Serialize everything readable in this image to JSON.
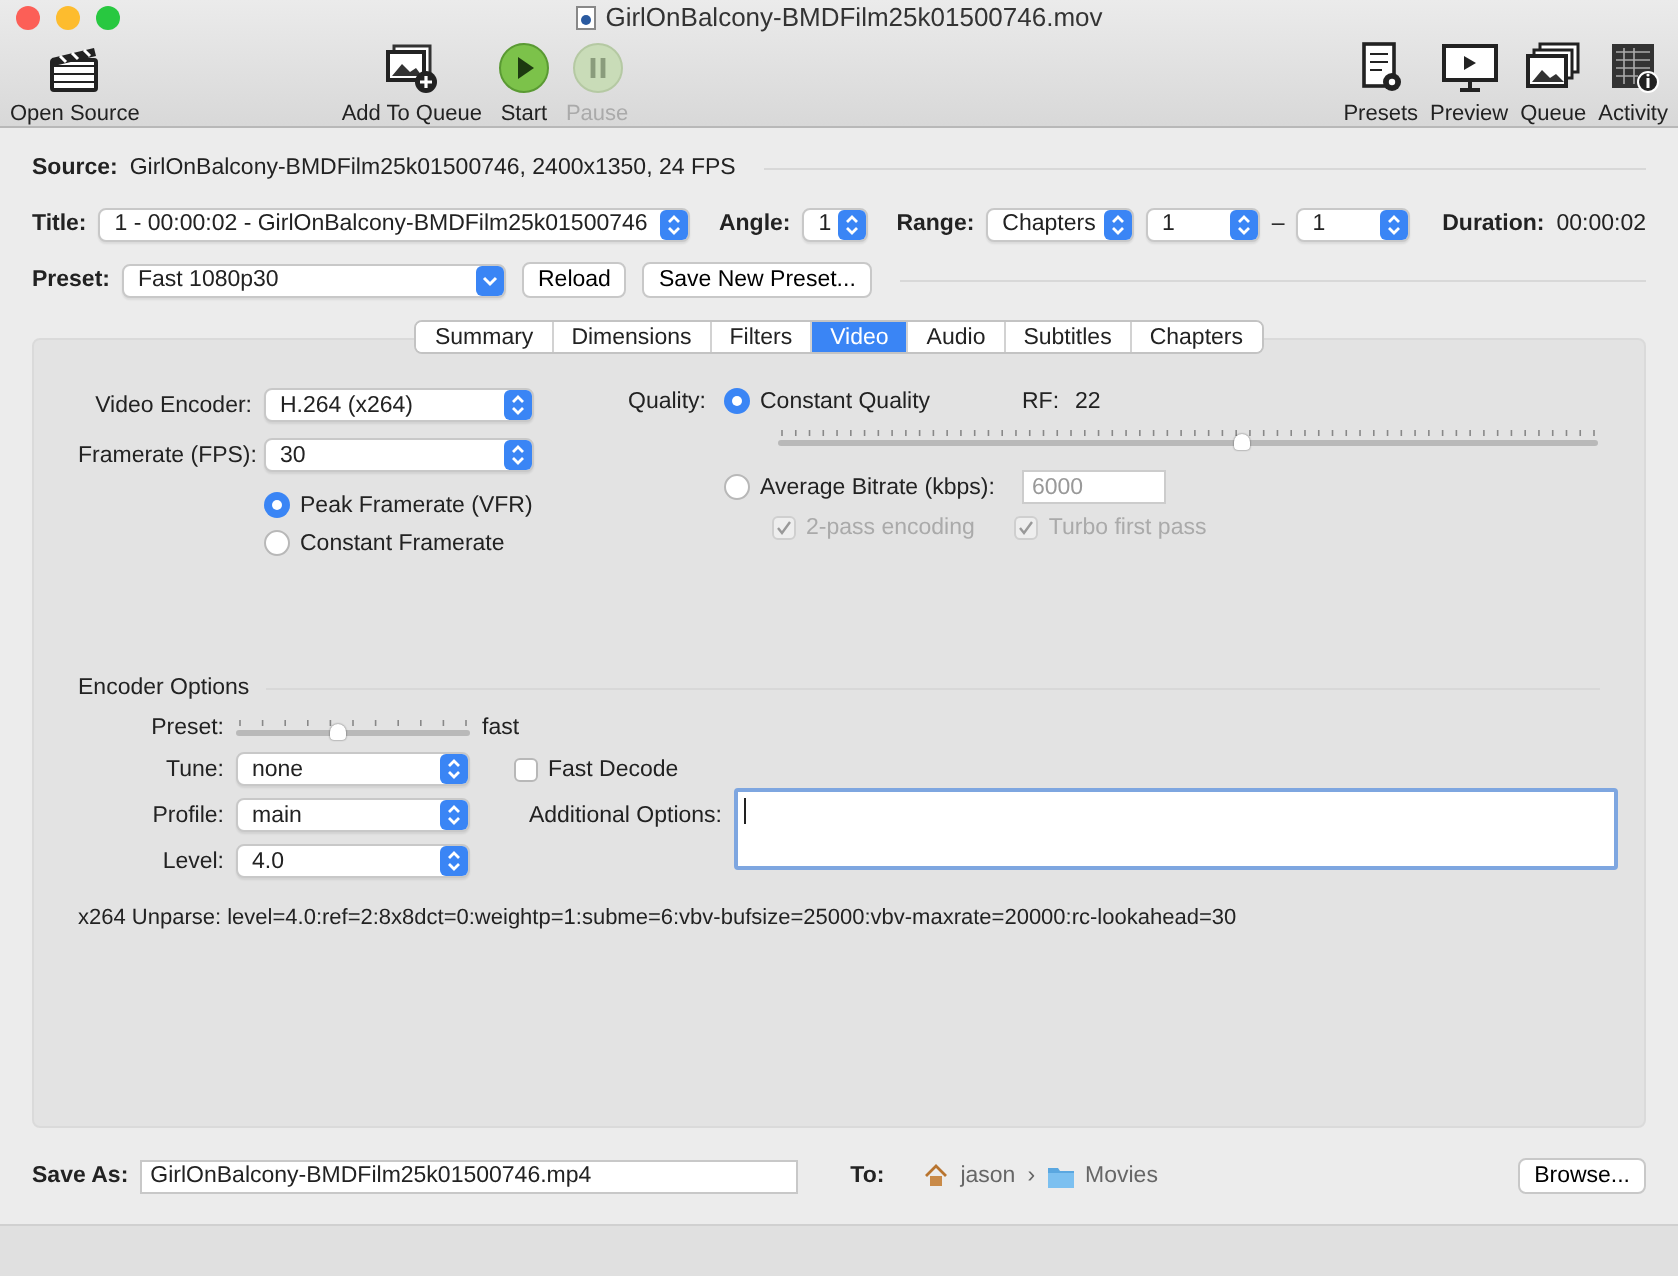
{
  "window": {
    "title": "GirlOnBalcony-BMDFilm25k01500746.mov"
  },
  "toolbar": {
    "left": [
      {
        "kind": "clapper",
        "label": "Open Source",
        "disabled": false
      },
      {
        "kind": "add-queue",
        "label": "Add To Queue",
        "disabled": false
      },
      {
        "kind": "start",
        "label": "Start",
        "disabled": false
      },
      {
        "kind": "pause",
        "label": "Pause",
        "disabled": true
      }
    ],
    "right": [
      {
        "kind": "presets",
        "label": "Presets",
        "disabled": false
      },
      {
        "kind": "preview",
        "label": "Preview",
        "disabled": false
      },
      {
        "kind": "queue",
        "label": "Queue",
        "disabled": false
      },
      {
        "kind": "activity",
        "label": "Activity",
        "disabled": false
      }
    ]
  },
  "source": {
    "label": "Source:",
    "value": "GirlOnBalcony-BMDFilm25k01500746, 2400x1350, 24 FPS"
  },
  "title_row": {
    "title_label": "Title:",
    "title_value": "1 - 00:00:02 - GirlOnBalcony-BMDFilm25k01500746",
    "angle_label": "Angle:",
    "angle_value": "1",
    "range_label": "Range:",
    "range_mode": "Chapters",
    "range_start": "1",
    "range_separator": "–",
    "range_end": "1",
    "duration_label": "Duration:",
    "duration_value": "00:00:02"
  },
  "preset_row": {
    "label": "Preset:",
    "value": "Fast 1080p30",
    "buttons": [
      "Reload",
      "Save New Preset..."
    ]
  },
  "tabs": [
    {
      "label": "Summary",
      "selected": false
    },
    {
      "label": "Dimensions",
      "selected": false
    },
    {
      "label": "Filters",
      "selected": false
    },
    {
      "label": "Video",
      "selected": true
    },
    {
      "label": "Audio",
      "selected": false
    },
    {
      "label": "Subtitles",
      "selected": false
    },
    {
      "label": "Chapters",
      "selected": false
    }
  ],
  "video": {
    "encoder": {
      "label": "Video Encoder:",
      "value": "H.264 (x264)"
    },
    "framerate": {
      "label": "Framerate (FPS):",
      "value": "30"
    },
    "framerate_modes": [
      {
        "label": "Peak Framerate (VFR)",
        "selected": true
      },
      {
        "label": "Constant Framerate",
        "selected": false
      }
    ],
    "quality_label": "Quality:",
    "quality_modes": [
      {
        "label": "Constant Quality",
        "selected": true
      },
      {
        "label": "Average Bitrate (kbps):",
        "selected": false
      }
    ],
    "rf_label": "RF:",
    "rf_value": "22",
    "rf_slider": {
      "level": 0.565
    },
    "bitrate": {
      "value": "6000",
      "disabled": true
    },
    "pass_options": [
      {
        "label": "2-pass encoding",
        "checked": true,
        "disabled": true
      },
      {
        "label": "Turbo first pass",
        "checked": true,
        "disabled": true
      }
    ]
  },
  "encoder_options": {
    "heading": "Encoder Options",
    "preset_label": "Preset:",
    "preset_slider": {
      "level": 0.44
    },
    "preset_value": "fast",
    "tune": {
      "label": "Tune:",
      "value": "none"
    },
    "fast_decode": {
      "label": "Fast Decode",
      "checked": false
    },
    "profile": {
      "label": "Profile:",
      "value": "main"
    },
    "additional_label": "Additional Options:",
    "level": {
      "label": "Level:",
      "value": "4.0"
    },
    "unparse": "x264 Unparse: level=4.0:ref=2:8x8dct=0:weightp=1:subme=6:vbv-bufsize=25000:vbv-maxrate=20000:rc-lookahead=30"
  },
  "save": {
    "label": "Save As:",
    "value": "GirlOnBalcony-BMDFilm25k01500746.mp4",
    "to_label": "To:",
    "path": [
      {
        "kind": "home",
        "label": "jason"
      },
      {
        "kind": "folder",
        "label": "Movies"
      }
    ],
    "path_separator": "›",
    "browse": "Browse..."
  }
}
